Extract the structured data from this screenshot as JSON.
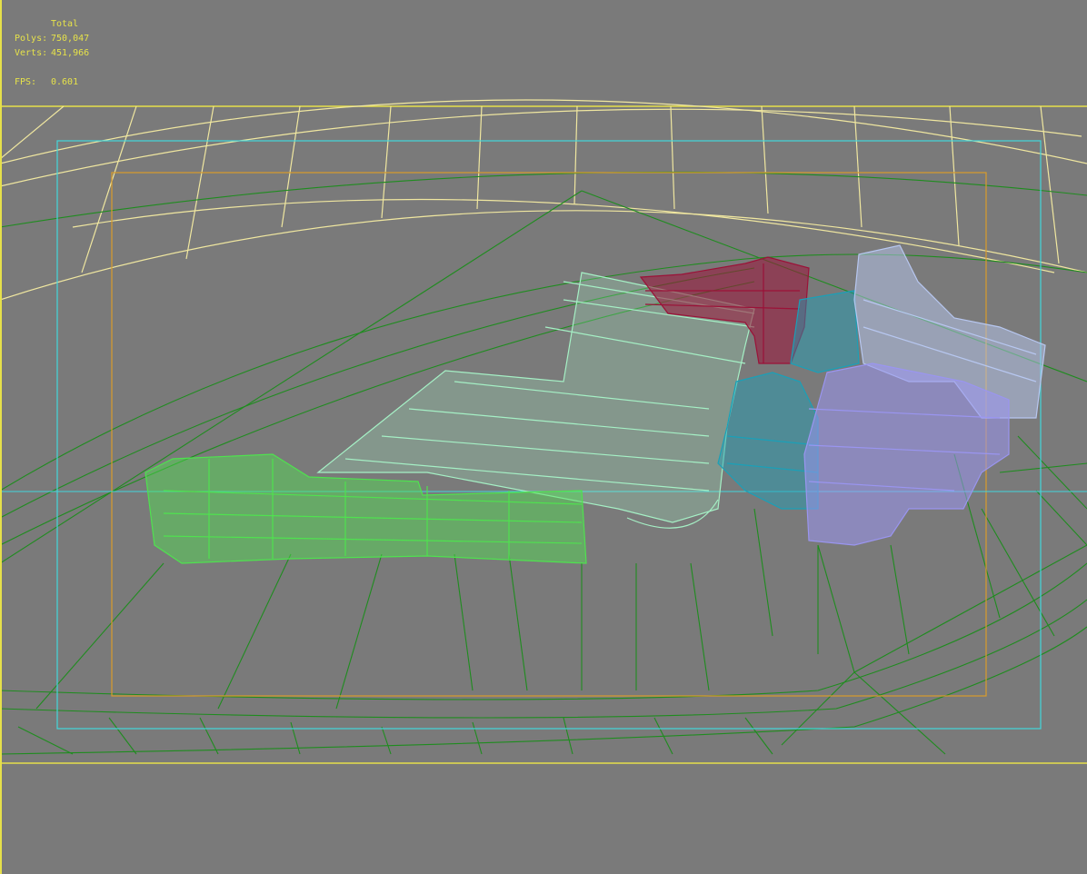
{
  "viewport_stats": {
    "heading": "Total",
    "polys_label": "Polys:",
    "polys_value": "750,047",
    "verts_label": "Verts:",
    "verts_value": "451,966",
    "fps_label": "FPS:",
    "fps_value": "0.601"
  },
  "colors": {
    "background": "#7a7a7a",
    "stats_text": "#e6e24a",
    "wire_green_terrain": "#1f8c1f",
    "safe_frame_cyan": "#43d7dc",
    "action_frame_orange": "#d99b2a",
    "dome_wire": "#f0e7a0",
    "building_light_green": "#4fe24f",
    "building_mint": "#a5f0c5",
    "building_crimson": "#9b1238",
    "building_teal": "#1aa0b8",
    "building_lavender": "#9a95f0",
    "building_light_blue": "#b7c7f0"
  },
  "icons": []
}
